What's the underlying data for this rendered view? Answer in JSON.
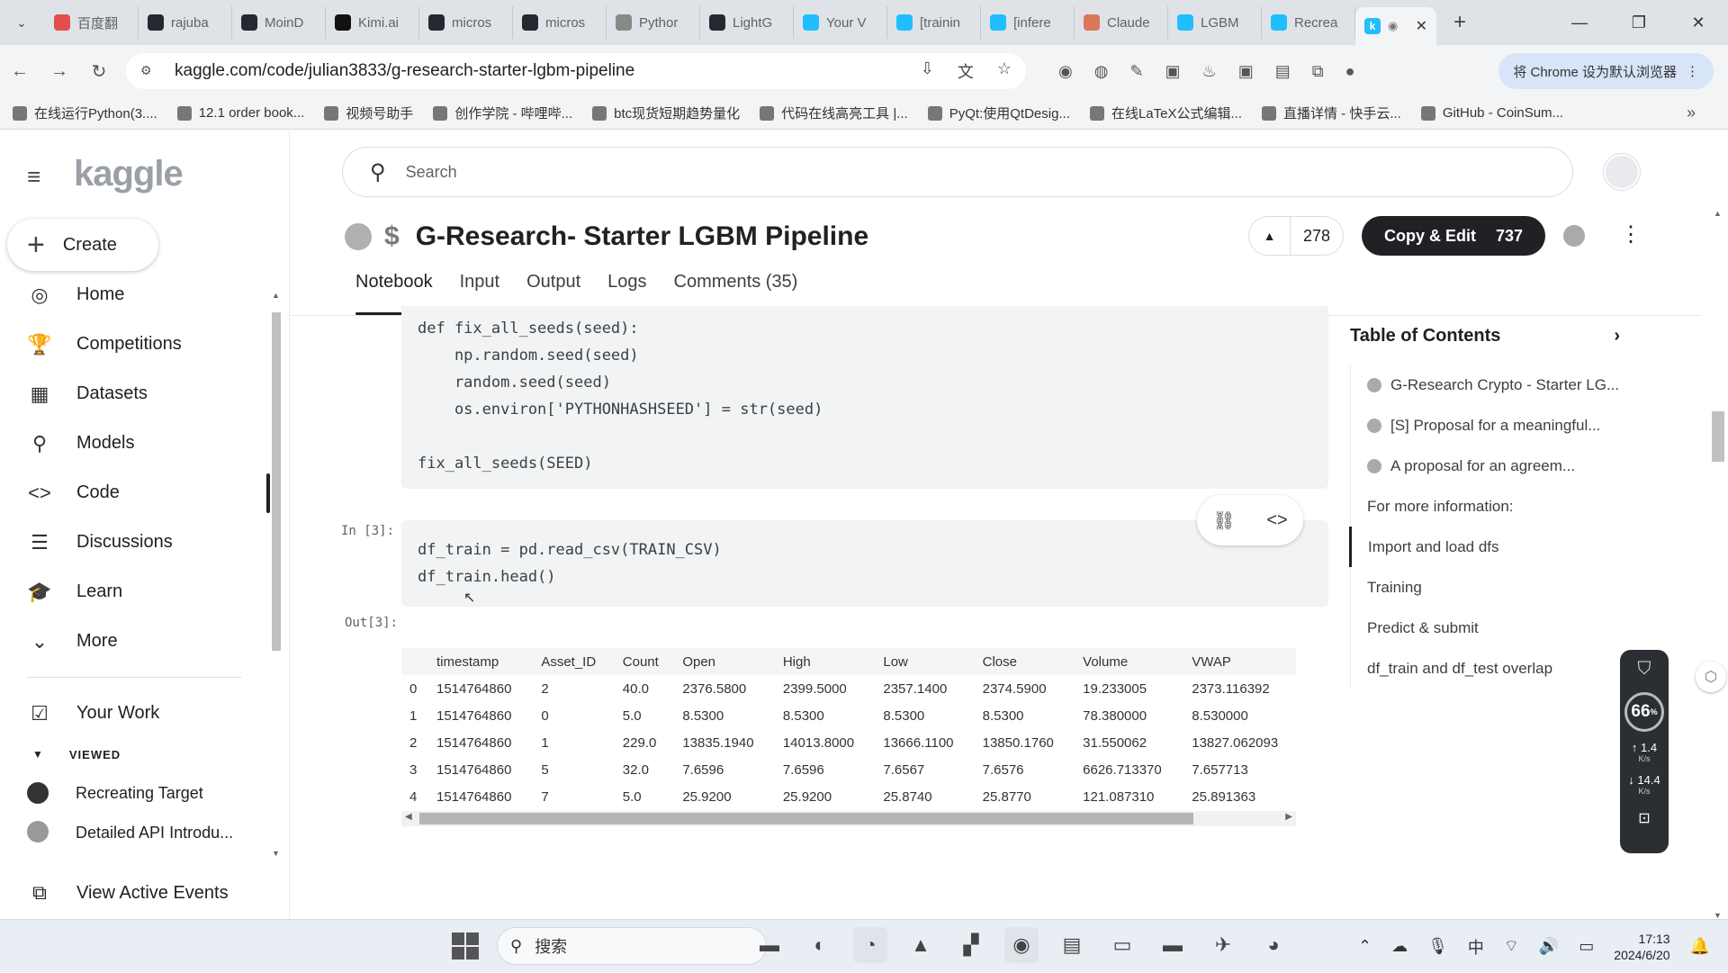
{
  "browser": {
    "tabs": [
      {
        "label": "百度翻",
        "color": "#e34d4d"
      },
      {
        "label": "rajuba",
        "color": "#24292f"
      },
      {
        "label": "MoinD",
        "color": "#24292f"
      },
      {
        "label": "Kimi.ai",
        "color": "#111111"
      },
      {
        "label": "micros",
        "color": "#24292f"
      },
      {
        "label": "micros",
        "color": "#24292f"
      },
      {
        "label": "Pythor",
        "color": "#888888"
      },
      {
        "label": "LightG",
        "color": "#24292f"
      },
      {
        "label": "Your V",
        "color": "#20beff"
      },
      {
        "label": "[trainin",
        "color": "#20beff"
      },
      {
        "label": "[infere",
        "color": "#20beff"
      },
      {
        "label": "Claude",
        "color": "#d97757"
      },
      {
        "label": "LGBM",
        "color": "#20beff"
      },
      {
        "label": "Recrea",
        "color": "#20beff"
      }
    ],
    "url": "kaggle.com/code/julian3833/g-research-starter-lgbm-pipeline",
    "default_browser_label": "将 Chrome 设为默认浏览器",
    "bookmarks": [
      "在线运行Python(3....",
      "12.1 order book...",
      "视频号助手",
      "创作学院 - 哔哩哔...",
      "btc现货短期趋势量化",
      "代码在线高亮工具 |...",
      "PyQt:使用QtDesig...",
      "在线LaTeX公式编辑...",
      "直播详情 - 快手云...",
      "GitHub - CoinSum..."
    ]
  },
  "sidebar": {
    "logo": "kaggle",
    "create_label": "Create",
    "items": [
      {
        "label": "Home",
        "icon": "◎"
      },
      {
        "label": "Competitions",
        "icon": "🏆"
      },
      {
        "label": "Datasets",
        "icon": "▦"
      },
      {
        "label": "Models",
        "icon": "⚲"
      },
      {
        "label": "Code",
        "icon": "<>"
      },
      {
        "label": "Discussions",
        "icon": "☰"
      },
      {
        "label": "Learn",
        "icon": "🎓"
      },
      {
        "label": "More",
        "icon": "⌄"
      }
    ],
    "your_work": "Your Work",
    "viewed_heading": "VIEWED",
    "viewed_items": [
      "Recreating Target",
      "Detailed API Introdu..."
    ],
    "active_events": "View Active Events"
  },
  "header": {
    "search_placeholder": "Search",
    "title": "G-Research- Starter LGBM Pipeline",
    "votes": "278",
    "copy_edit_label": "Copy & Edit",
    "copy_edit_count": "737",
    "tabs": [
      "Notebook",
      "Input",
      "Output",
      "Logs",
      "Comments (35)"
    ]
  },
  "notebook": {
    "cell1_code": "def fix_all_seeds(seed):\n    np.random.seed(seed)\n    random.seed(seed)\n    os.environ['PYTHONHASHSEED'] = str(seed)\n\nfix_all_seeds(SEED)",
    "cell2_prompt": "In [3]:",
    "cell2_code": "df_train = pd.read_csv(TRAIN_CSV)\ndf_train.head()",
    "out_prompt": "Out[3]:",
    "table": {
      "columns": [
        "",
        "timestamp",
        "Asset_ID",
        "Count",
        "Open",
        "High",
        "Low",
        "Close",
        "Volume",
        "VWAP"
      ],
      "rows": [
        [
          "0",
          "1514764860",
          "2",
          "40.0",
          "2376.5800",
          "2399.5000",
          "2357.1400",
          "2374.5900",
          "19.233005",
          "2373.116392"
        ],
        [
          "1",
          "1514764860",
          "0",
          "5.0",
          "8.5300",
          "8.5300",
          "8.5300",
          "8.5300",
          "78.380000",
          "8.530000"
        ],
        [
          "2",
          "1514764860",
          "1",
          "229.0",
          "13835.1940",
          "14013.8000",
          "13666.1100",
          "13850.1760",
          "31.550062",
          "13827.062093"
        ],
        [
          "3",
          "1514764860",
          "5",
          "32.0",
          "7.6596",
          "7.6596",
          "7.6567",
          "7.6576",
          "6626.713370",
          "7.657713"
        ],
        [
          "4",
          "1514764860",
          "7",
          "5.0",
          "25.9200",
          "25.9200",
          "25.8740",
          "25.8770",
          "121.087310",
          "25.891363"
        ]
      ]
    }
  },
  "toc": {
    "title": "Table of Contents",
    "items": [
      "G-Research Crypto - Starter LG...",
      "[S]  Proposal for a meaningful...",
      "A proposal for an agreem...",
      "For more information:",
      "Import and load dfs",
      "Training",
      "Predict & submit",
      "df_train and df_test overlap"
    ]
  },
  "net_widget": {
    "percent": "66",
    "up": "1.4",
    "down": "14.4",
    "unit": "K/s"
  },
  "taskbar": {
    "search_label": "搜索",
    "ime": "中",
    "time": "17:13",
    "date": "2024/6/20"
  }
}
